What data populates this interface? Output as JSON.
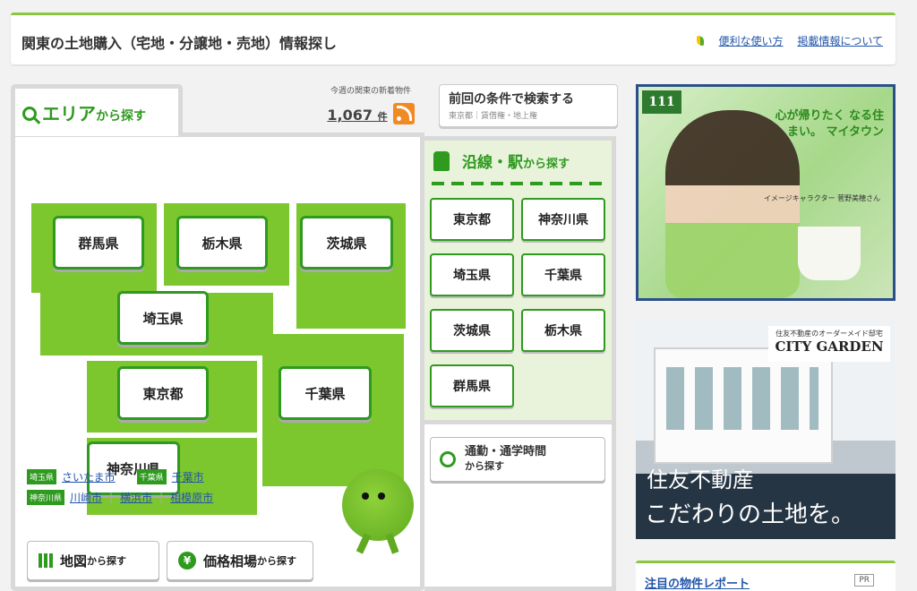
{
  "header": {
    "title": "関東の土地購入（宅地・分譲地・売地）情報探し",
    "links": [
      "便利な使い方",
      "掲載情報について"
    ]
  },
  "area_tab": {
    "label_main": "エリア",
    "label_sub": "から探す"
  },
  "new_listings": {
    "label": "今週の関東の新着物件",
    "count": "1,067",
    "unit": "件"
  },
  "previous_search": {
    "title": "前回の条件で検索する",
    "detail": "東京都｜賃借権・地上権"
  },
  "map_prefectures": [
    "群馬県",
    "栃木県",
    "茨城県",
    "埼玉県",
    "東京都",
    "千葉県",
    "神奈川県"
  ],
  "city_links": {
    "row1": [
      {
        "tag": "埼玉県",
        "links": [
          "さいたま市"
        ]
      },
      {
        "tag": "千葉県",
        "links": [
          "千葉市"
        ]
      }
    ],
    "row2": [
      {
        "tag": "神奈川県",
        "links": [
          "川崎市",
          "横浜市",
          "相模原市"
        ]
      }
    ]
  },
  "bottom_buttons": [
    {
      "main": "地図",
      "sub": "から探す",
      "icon": "map-icon"
    },
    {
      "main": "価格相場",
      "sub": "から探す",
      "icon": "yen-icon"
    }
  ],
  "line_search": {
    "label_main": "沿線・駅",
    "label_sub": "から探す",
    "prefectures": [
      "東京都",
      "神奈川県",
      "埼玉県",
      "千葉県",
      "茨城県",
      "栃木県",
      "群馬県"
    ]
  },
  "commute": {
    "main": "通勤・通学時間",
    "sub": "から探す"
  },
  "ad1": {
    "logo": "111",
    "copy": "心が帰りたく なる住まい。 マイタウン",
    "caption": "イメージキャラクター 菅野美穂さん"
  },
  "ad2": {
    "brand_small": "住友不動産のオーダーメイド邸宅",
    "brand_large": "CITY GARDEN",
    "headline1": "住友不動産",
    "headline2": "こだわりの土地を。"
  },
  "report": {
    "title": "注目の物件レポート",
    "badge": "PR"
  },
  "colors": {
    "accent": "#2e9a1e",
    "map_fill": "#7cc62e",
    "link": "#2255aa"
  }
}
